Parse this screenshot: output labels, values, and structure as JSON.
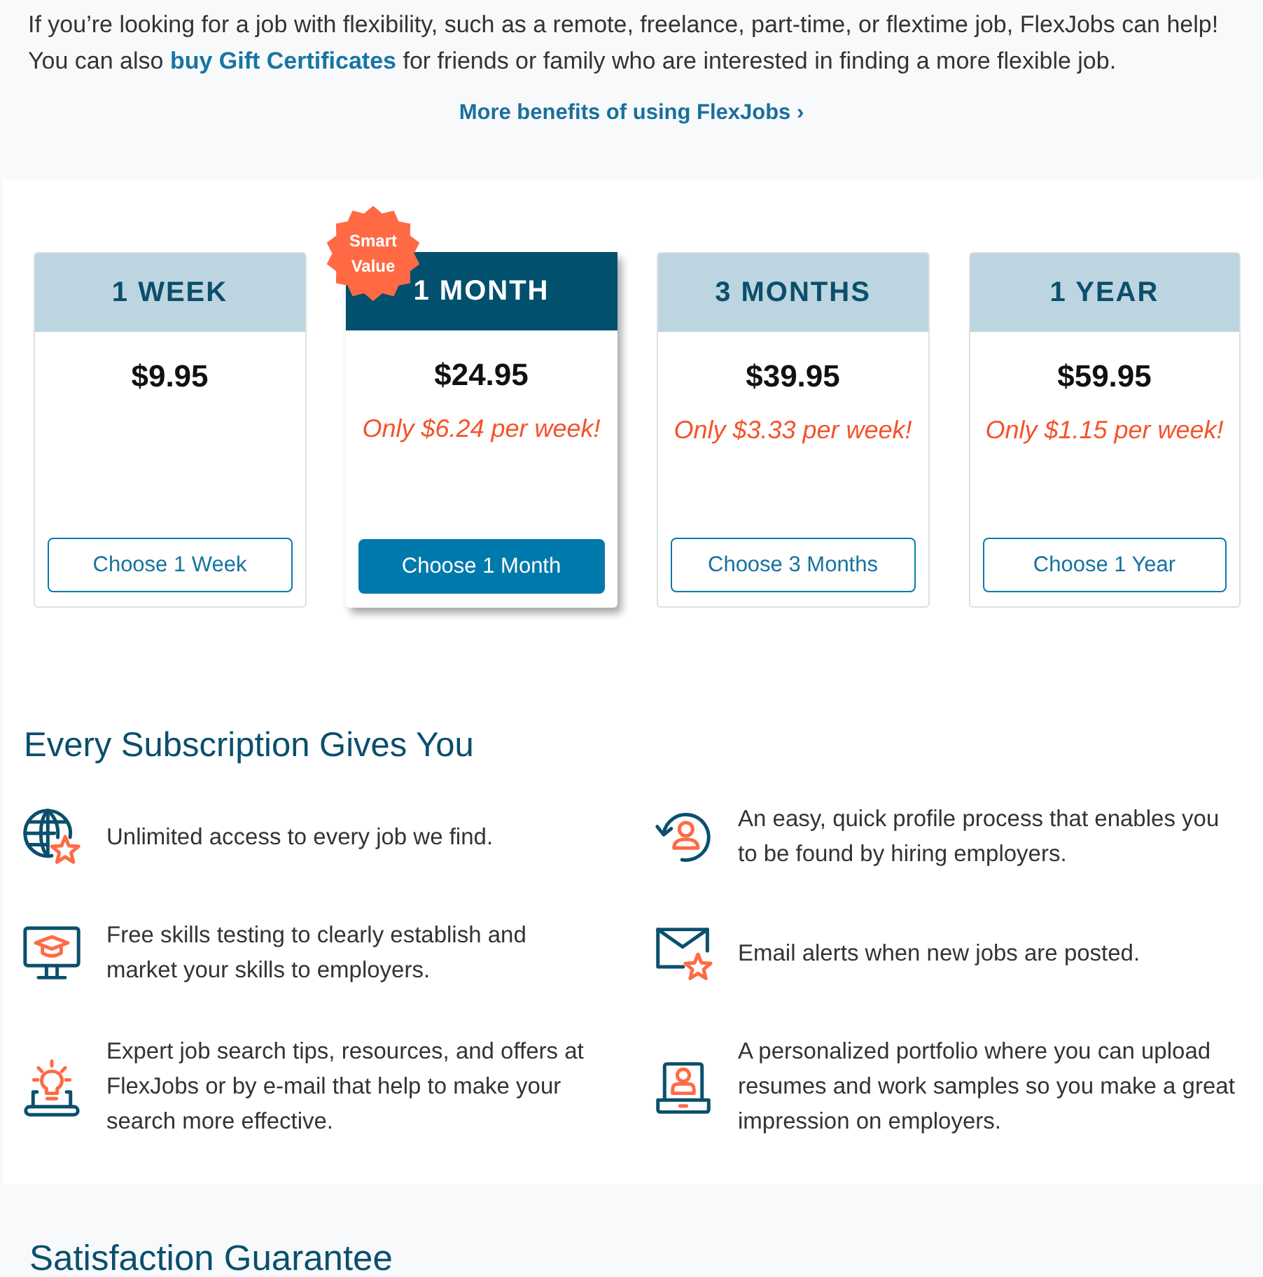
{
  "intro": {
    "text_1": "If you’re looking for a job with flexibility, such as a remote, freelance, part-time, or flextime job, FlexJobs can help!",
    "text_2": "You can also",
    "link": "buy Gift Certificates",
    "text_3": "for friends or family who are interested in finding a more flexible job."
  },
  "benefits_link": "More benefits of using FlexJobs ›",
  "plans": [
    {
      "name": "1 WEEK",
      "selected": false,
      "price": "$9.95",
      "button": "Choose 1 Week"
    },
    {
      "name": "1 MONTH",
      "selected": true,
      "badge": "Smart Value",
      "price": "$24.95",
      "per_week": "Only $6.24 per week!",
      "button": "Choose 1 Month"
    },
    {
      "name": "3 MONTHS",
      "selected": false,
      "price": "$39.95",
      "per_week": "Only $3.33 per week!",
      "button": "Choose 3 Months"
    },
    {
      "name": "1 YEAR",
      "selected": false,
      "price": "$59.95",
      "per_week": "Only $1.15 per week!",
      "button": "Choose 1 Year"
    }
  ],
  "subscription": {
    "title": "Every Subscription Gives You",
    "features": [
      "Unlimited access to every job we find.",
      "Free skills testing to clearly establish and market your skills to employers.",
      "Expert job search tips, resources, and offers at FlexJobs or by e-mail that help to make your search more effective.",
      "An easy, quick profile process that enables you to be found by hiring employers.",
      "Email alerts when new jobs are posted.",
      "A personalized portfolio where you can upload resumes and work samples so you make a great impression on employers."
    ]
  },
  "guarantee": {
    "title": "Satisfaction Guarantee"
  }
}
